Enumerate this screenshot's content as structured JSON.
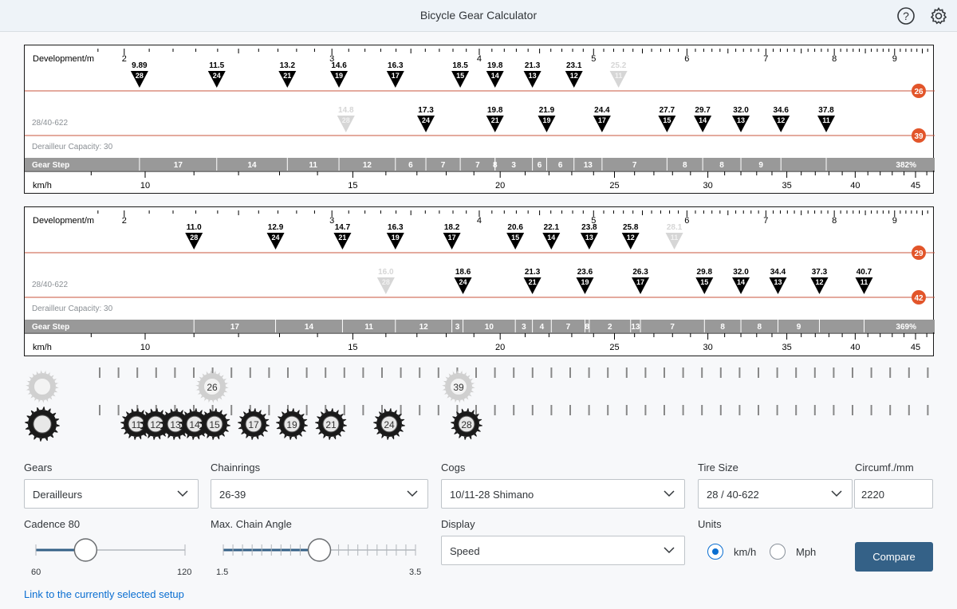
{
  "header": {
    "title": "Bicycle Gear Calculator",
    "help_icon": "help-icon",
    "settings_icon": "gear-icon"
  },
  "chart_data": [
    {
      "type": "gear-chart",
      "development_label": "Development/m",
      "development_ticks": [
        "2",
        "3",
        "4",
        "5",
        "6",
        "7",
        "8",
        "9"
      ],
      "setup_label": "28/40-622",
      "capacity_label": "Derailleur Capacity: 30",
      "gear_step_label": "Gear Step",
      "gear_steps": [
        "17",
        "14",
        "11",
        "12",
        "6",
        "7",
        "7",
        "8",
        "3",
        "6",
        "6",
        "13",
        "7",
        "8",
        "8",
        "9"
      ],
      "gear_step_total": "382%",
      "speed_label": "km/h",
      "speed_ticks": [
        "10",
        "15",
        "20",
        "25",
        "30",
        "35",
        "40",
        "45"
      ],
      "rings": [
        {
          "ring": "26",
          "gears": [
            {
              "speed": "9.89",
              "cog": "28",
              "v": 9.89
            },
            {
              "speed": "11.5",
              "cog": "24",
              "v": 11.5
            },
            {
              "speed": "13.2",
              "cog": "21",
              "v": 13.2
            },
            {
              "speed": "14.6",
              "cog": "19",
              "v": 14.6
            },
            {
              "speed": "16.3",
              "cog": "17",
              "v": 16.3
            },
            {
              "speed": "18.5",
              "cog": "15",
              "v": 18.5
            },
            {
              "speed": "19.8",
              "cog": "14",
              "v": 19.8
            },
            {
              "speed": "21.3",
              "cog": "13",
              "v": 21.3
            },
            {
              "speed": "23.1",
              "cog": "12",
              "v": 23.1
            },
            {
              "speed": "25.2",
              "cog": "11",
              "v": 25.2,
              "disabled": true
            }
          ]
        },
        {
          "ring": "39",
          "gears": [
            {
              "speed": "14.8",
              "cog": "28",
              "v": 14.8,
              "disabled": true
            },
            {
              "speed": "17.3",
              "cog": "24",
              "v": 17.3
            },
            {
              "speed": "19.8",
              "cog": "21",
              "v": 19.8
            },
            {
              "speed": "21.9",
              "cog": "19",
              "v": 21.9
            },
            {
              "speed": "24.4",
              "cog": "17",
              "v": 24.4
            },
            {
              "speed": "27.7",
              "cog": "15",
              "v": 27.7
            },
            {
              "speed": "29.7",
              "cog": "14",
              "v": 29.7
            },
            {
              "speed": "32.0",
              "cog": "13",
              "v": 32.0
            },
            {
              "speed": "34.6",
              "cog": "12",
              "v": 34.6
            },
            {
              "speed": "37.8",
              "cog": "11",
              "v": 37.8
            }
          ]
        }
      ]
    },
    {
      "type": "gear-chart",
      "development_label": "Development/m",
      "development_ticks": [
        "2",
        "3",
        "4",
        "5",
        "6",
        "7",
        "8",
        "9"
      ],
      "setup_label": "28/40-622",
      "capacity_label": "Derailleur Capacity: 30",
      "gear_step_label": "Gear Step",
      "gear_steps": [
        "17",
        "14",
        "11",
        "12",
        "3",
        "10",
        "3",
        "4",
        "7",
        "8",
        "2",
        "13",
        "7",
        "8",
        "8",
        "9"
      ],
      "gear_step_total": "369%",
      "speed_label": "km/h",
      "speed_ticks": [
        "10",
        "15",
        "20",
        "25",
        "30",
        "35",
        "40",
        "45"
      ],
      "rings": [
        {
          "ring": "29",
          "gears": [
            {
              "speed": "11.0",
              "cog": "28",
              "v": 11.0
            },
            {
              "speed": "12.9",
              "cog": "24",
              "v": 12.9
            },
            {
              "speed": "14.7",
              "cog": "21",
              "v": 14.7
            },
            {
              "speed": "16.3",
              "cog": "19",
              "v": 16.3
            },
            {
              "speed": "18.2",
              "cog": "17",
              "v": 18.2
            },
            {
              "speed": "20.6",
              "cog": "15",
              "v": 20.6
            },
            {
              "speed": "22.1",
              "cog": "14",
              "v": 22.1
            },
            {
              "speed": "23.8",
              "cog": "13",
              "v": 23.8
            },
            {
              "speed": "25.8",
              "cog": "12",
              "v": 25.8
            },
            {
              "speed": "28.1",
              "cog": "11",
              "v": 28.1,
              "disabled": true
            }
          ]
        },
        {
          "ring": "42",
          "gears": [
            {
              "speed": "16.0",
              "cog": "28",
              "v": 16.0,
              "disabled": true
            },
            {
              "speed": "18.6",
              "cog": "24",
              "v": 18.6
            },
            {
              "speed": "21.3",
              "cog": "21",
              "v": 21.3
            },
            {
              "speed": "23.6",
              "cog": "19",
              "v": 23.6
            },
            {
              "speed": "26.3",
              "cog": "17",
              "v": 26.3
            },
            {
              "speed": "29.8",
              "cog": "15",
              "v": 29.8
            },
            {
              "speed": "32.0",
              "cog": "14",
              "v": 32.0
            },
            {
              "speed": "34.4",
              "cog": "13",
              "v": 34.4
            },
            {
              "speed": "37.3",
              "cog": "12",
              "v": 37.3
            },
            {
              "speed": "40.7",
              "cog": "11",
              "v": 40.7
            }
          ]
        }
      ]
    }
  ],
  "gear_visual": {
    "chainrings": [
      "26",
      "39"
    ],
    "cogs": [
      "11",
      "12",
      "13",
      "14",
      "15",
      "17",
      "19",
      "21",
      "24",
      "28"
    ]
  },
  "controls": {
    "gears": {
      "label": "Gears",
      "value": "Derailleurs"
    },
    "chainrings": {
      "label": "Chainrings",
      "value": "26-39"
    },
    "cogs": {
      "label": "Cogs",
      "value": "10/11-28 Shimano"
    },
    "tire_size": {
      "label": "Tire Size",
      "value": "28 / 40-622"
    },
    "circumference": {
      "label": "Circumf./mm",
      "value": "2220"
    },
    "cadence": {
      "label": "Cadence 80",
      "min": "60",
      "max": "120",
      "value": 80
    },
    "chain_angle": {
      "label": "Max. Chain Angle",
      "min": "1.5",
      "max": "3.5",
      "value": 2.5
    },
    "display": {
      "label": "Display",
      "value": "Speed"
    },
    "units": {
      "label": "Units",
      "kmh": "km/h",
      "mph": "Mph",
      "selected": "km/h"
    },
    "compare": "Compare",
    "link": "Link to the currently selected setup"
  }
}
